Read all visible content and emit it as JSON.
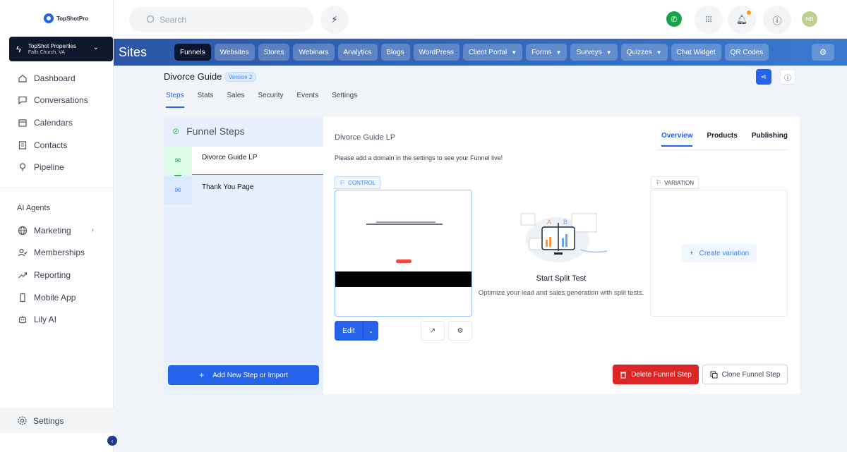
{
  "brand": {
    "name": "TopShotPro"
  },
  "account": {
    "name": "TopShot Properties",
    "location": "Falls Church, VA"
  },
  "sidebar": {
    "items": [
      {
        "label": "Dashboard",
        "icon": "home-icon"
      },
      {
        "label": "Conversations",
        "icon": "chat-icon"
      },
      {
        "label": "Calendars",
        "icon": "calendar-icon"
      },
      {
        "label": "Contacts",
        "icon": "contacts-icon"
      },
      {
        "label": "Pipeline",
        "icon": "funnel-icon"
      }
    ],
    "section_label": "AI Agents",
    "items2": [
      {
        "label": "Marketing",
        "icon": "globe-icon"
      },
      {
        "label": "Memberships",
        "icon": "membership-icon"
      },
      {
        "label": "Reporting",
        "icon": "trend-icon"
      },
      {
        "label": "Mobile App",
        "icon": "phone-icon"
      },
      {
        "label": "Lily AI",
        "icon": "robot-icon"
      }
    ],
    "settings_label": "Settings"
  },
  "topbar": {
    "search_placeholder": "Search",
    "avatar_initials": "NB"
  },
  "sites": {
    "title": "Sites",
    "tabs": [
      "Funnels",
      "Websites",
      "Stores",
      "Webinars",
      "Analytics",
      "Blogs",
      "WordPress",
      "Client Portal",
      "Forms",
      "Surveys",
      "Quizzes",
      "Chat Widget",
      "QR Codes"
    ]
  },
  "funnel": {
    "title": "Divorce Guide",
    "version": "Version 2",
    "tabs": [
      "Steps",
      "Stats",
      "Sales",
      "Security",
      "Events",
      "Settings"
    ]
  },
  "steps": {
    "header": "Funnel Steps",
    "items": [
      "Divorce Guide LP",
      "Thank You Page"
    ],
    "add_button": "Add New Step or Import"
  },
  "page": {
    "name": "Divorce Guide LP",
    "view_tabs": [
      "Overview",
      "Products",
      "Publishing"
    ],
    "domain_note": "Please add a domain in the settings to see your Funnel live!",
    "control_label": "CONTROL",
    "variation_label": "VARIATION",
    "edit_label": "Edit",
    "split_title": "Start Split Test",
    "split_desc": "Optimize your lead and sales generation with split tests.",
    "create_variation": "Create variation",
    "delete_step": "Delete Funnel Step",
    "clone_step": "Clone Funnel Step"
  },
  "colors": {
    "primary": "#2563eb",
    "danger": "#dc2626",
    "success": "#22c55e",
    "sidebar_dark": "#0f172a"
  }
}
